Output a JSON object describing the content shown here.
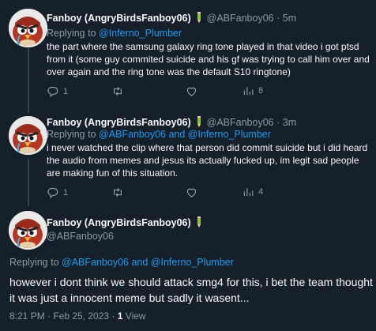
{
  "tweets": [
    {
      "name": "Fanboy (AngryBirdsFanboy06)",
      "handle": "@ABFanboy06",
      "separator": "·",
      "time": "5m",
      "reply_prefix": "Replying to",
      "reply_to": "@Inferno_Plumber",
      "body": "the part where the samsung galaxy ring tone played in that video i got ptsd from it (some guy commited suicide and his gf was trying to call him over and over again and the ring tone was the default S10 ringtone)",
      "replies": "1",
      "views": "8"
    },
    {
      "name": "Fanboy (AngryBirdsFanboy06)",
      "handle": "@ABFanboy06",
      "separator": "·",
      "time": "3m",
      "reply_prefix": "Replying to",
      "reply_to": "@ABFanboy06 and @Inferno_Plumber",
      "body": "i never watched the clip where that person did commit suicide but i did heard the audio from memes and jesus its actually fucked up, im legit sad people are making fun of this situation.",
      "replies": "1",
      "views": "4"
    }
  ],
  "main_tweet": {
    "name": "Fanboy (AngryBirdsFanboy06)",
    "handle": "@ABFanboy06",
    "reply_prefix": "Replying to",
    "reply_to": "@ABFanboy06 and @Inferno_Plumber",
    "body": "however i dont think we should attack smg4 for this, i bet the team thought it was just a innocent meme but sadly it wasent...",
    "timestamp": "8:21 PM · Feb 25, 2023 ·",
    "views_count": "1",
    "views_label": "View"
  },
  "colors": {
    "background": "#15202b",
    "text": "#f7f9f9",
    "secondary": "#8b98a5",
    "link": "#1d9bf0",
    "thread_line": "#38444d"
  },
  "icons": [
    "reply-icon",
    "retweet-icon",
    "like-icon",
    "views-icon",
    "pencil-emoji-icon"
  ]
}
